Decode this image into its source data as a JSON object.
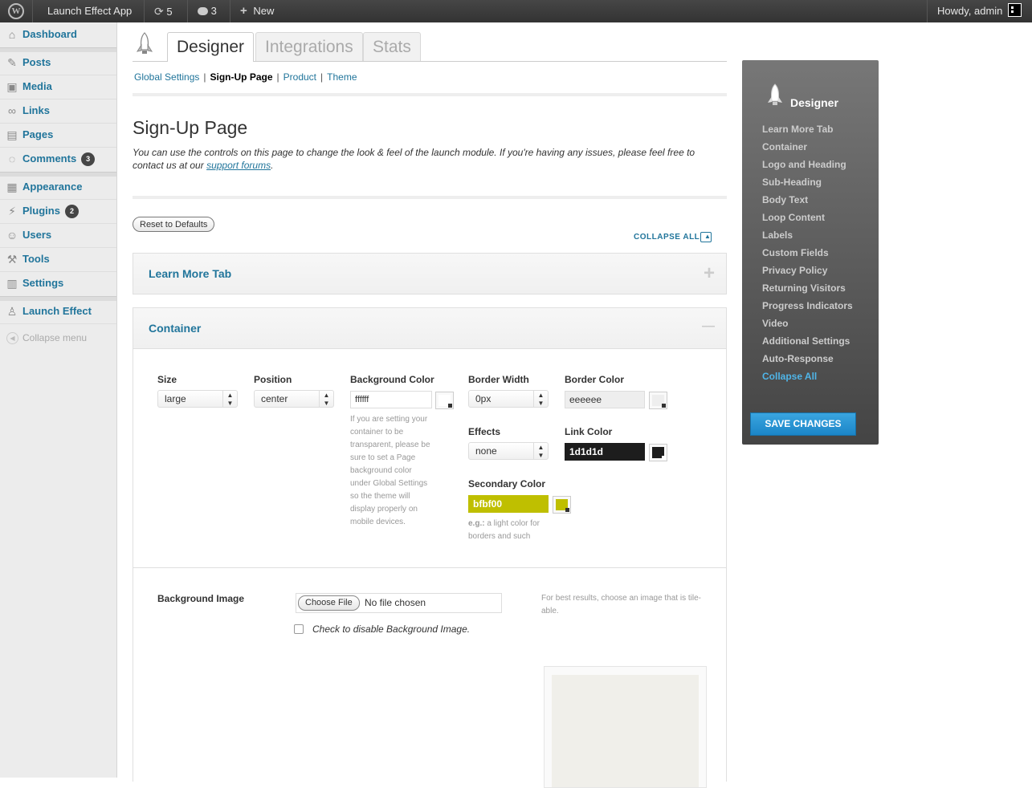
{
  "adminbar": {
    "site_name": "Launch Effect App",
    "updates_count": "5",
    "comments_count": "3",
    "new_label": "New",
    "howdy": "Howdy, admin"
  },
  "sidebar": {
    "items": [
      {
        "label": "Dashboard",
        "icon": "home-icon"
      },
      {
        "label": "Posts",
        "icon": "pin-icon"
      },
      {
        "label": "Media",
        "icon": "media-icon"
      },
      {
        "label": "Links",
        "icon": "link-icon"
      },
      {
        "label": "Pages",
        "icon": "page-icon"
      },
      {
        "label": "Comments",
        "icon": "comment-icon",
        "count": "3"
      },
      {
        "label": "Appearance",
        "icon": "appearance-icon"
      },
      {
        "label": "Plugins",
        "icon": "plugin-icon",
        "count": "2"
      },
      {
        "label": "Users",
        "icon": "users-icon"
      },
      {
        "label": "Tools",
        "icon": "tools-icon"
      },
      {
        "label": "Settings",
        "icon": "settings-icon"
      },
      {
        "label": "Launch Effect",
        "icon": "rocket-icon"
      }
    ],
    "collapse_label": "Collapse menu"
  },
  "tabs": [
    "Designer",
    "Integrations",
    "Stats"
  ],
  "subnav": [
    "Global Settings",
    "Sign-Up Page",
    "Product",
    "Theme"
  ],
  "page": {
    "title": "Sign-Up Page",
    "intro": "You can use the controls on this page to change the look & feel of the launch module. If you're having any issues, please feel free to contact us at our ",
    "intro_link": "support forums",
    "intro_end": ".",
    "reset_label": "Reset to Defaults",
    "collapse_all_label": "COLLAPSE ALL"
  },
  "sections": {
    "learn_more": {
      "title": "Learn More Tab",
      "toggle": "+"
    },
    "container": {
      "title": "Container",
      "toggle": "—",
      "size": {
        "label": "Size",
        "value": "large"
      },
      "position": {
        "label": "Position",
        "value": "center"
      },
      "background_color": {
        "label": "Background Color",
        "value": "ffffff",
        "swatch": "#ffffff",
        "help": "If you are setting your container to be transparent, please be sure to set a Page background color under Global Settings so the theme will display properly on mobile devices."
      },
      "border_width": {
        "label": "Border Width",
        "value": "0px"
      },
      "border_color": {
        "label": "Border Color",
        "value": "eeeeee",
        "swatch": "#eeeeee"
      },
      "effects": {
        "label": "Effects",
        "value": "none"
      },
      "link_color": {
        "label": "Link Color",
        "value": "1d1d1d",
        "swatch": "#1d1d1d"
      },
      "secondary_color": {
        "label": "Secondary Color",
        "value": "bfbf00",
        "swatch": "#bfbf00",
        "help_bold": "e.g.:",
        "help": " a light color for borders and such"
      },
      "background_image": {
        "label": "Background Image",
        "choose_label": "Choose File",
        "file_status": "No file chosen",
        "disable_label": "Check to disable Background Image.",
        "help": "For best results, choose an image that is tile-able."
      }
    }
  },
  "panel": {
    "title": "Designer",
    "items": [
      "Learn More Tab",
      "Container",
      "Logo and Heading",
      "Sub-Heading",
      "Body Text",
      "Loop Content",
      "Labels",
      "Custom Fields",
      "Privacy Policy",
      "Returning Visitors",
      "Progress Indicators",
      "Video",
      "Additional Settings",
      "Auto-Response",
      "Collapse All"
    ],
    "save_label": "SAVE CHANGES"
  },
  "colors": {
    "link_blue": "#21759b",
    "active_blue": "#4fb5e8",
    "secondary_yellow": "#bfbf00",
    "dark_input": "#1d1d1d"
  }
}
